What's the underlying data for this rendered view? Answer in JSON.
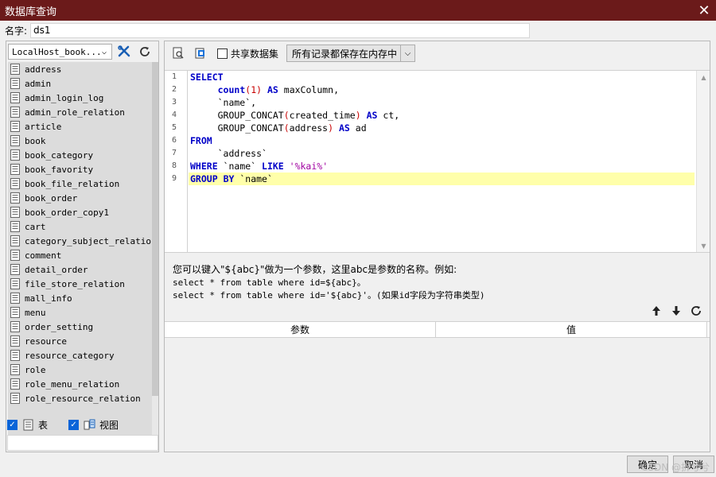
{
  "window": {
    "title": "数据库查询",
    "close_glyph": "✕"
  },
  "name_field": {
    "label": "名字:",
    "value": "ds1"
  },
  "datasource": {
    "selected": "LocalHost_book...",
    "dropdown_glyph": "⌵"
  },
  "tables": [
    "address",
    "admin",
    "admin_login_log",
    "admin_role_relation",
    "article",
    "book",
    "book_category",
    "book_favority",
    "book_file_relation",
    "book_order",
    "book_order_copy1",
    "cart",
    "category_subject_relation",
    "comment",
    "detail_order",
    "file_store_relation",
    "mall_info",
    "menu",
    "order_setting",
    "resource",
    "resource_category",
    "role",
    "role_menu_relation",
    "role_resource_relation"
  ],
  "filters": {
    "table_label": "表",
    "view_label": "视图",
    "check_glyph": "✓"
  },
  "toolbar": {
    "share_label": "共享数据集",
    "mode_selected": "所有记录都保存在内存中",
    "dropdown_glyph": "⌵"
  },
  "editor": {
    "line_numbers": [
      "1",
      "2",
      "3",
      "4",
      "5",
      "6",
      "7",
      "8",
      "9"
    ],
    "active_line": 9
  },
  "help": {
    "line1": "您可以键入\"${abc}\"做为一个参数，这里abc是参数的名称。例如:",
    "line2": "select * from table where id=${abc}。",
    "line3": "select * from table where id='${abc}'。(如果id字段为字符串类型)"
  },
  "param_grid": {
    "col_param": "参数",
    "col_value": "值"
  },
  "footer": {
    "ok_label": "确定",
    "cancel_label": "取消"
  },
  "watermark": "CSDN @拆兮兮"
}
